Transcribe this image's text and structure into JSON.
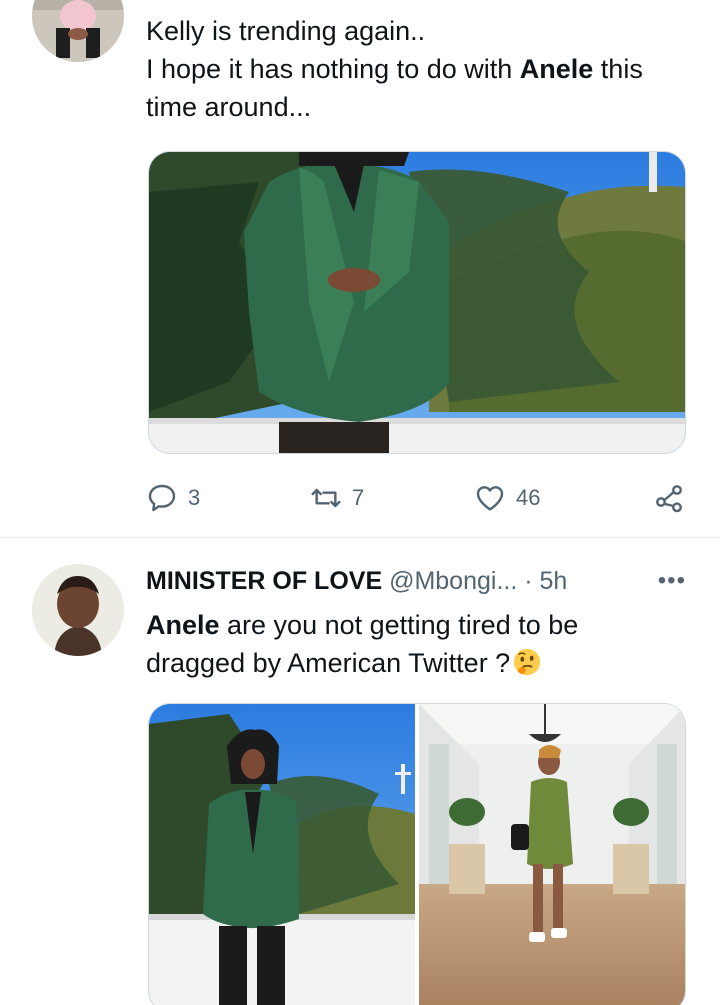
{
  "tweet1": {
    "text_line1": "Kelly is trending again..",
    "text_line2_pre": "I hope it has nothing to do with ",
    "text_line2_bold": "Anele",
    "text_line2_post": " this",
    "text_line3": "time around...",
    "media": {
      "description_icon": "photo-green-blazer"
    },
    "actions": {
      "reply_count": "3",
      "retweet_count": "7",
      "like_count": "46",
      "reply_icon": "reply-icon",
      "retweet_icon": "retweet-icon",
      "like_icon": "heart-icon",
      "share_icon": "share-icon"
    }
  },
  "tweet2": {
    "author_name": "MINISTER OF LOVE",
    "author_handle": "@Mbongi...",
    "separator": " · ",
    "time": "5h",
    "more_label": "•••",
    "text_bold": "Anele",
    "text_line1_post": " are you not getting tired to be",
    "text_line2": "dragged by American Twitter ?",
    "emoji": "thinking-face-icon"
  },
  "colors": {
    "text_primary": "#0f1419",
    "text_secondary": "#536471",
    "border": "#cfd9de",
    "divider": "#e6ecf0",
    "blazer_green": "#2f6b4a",
    "sky_blue": "#2f7fd8"
  }
}
